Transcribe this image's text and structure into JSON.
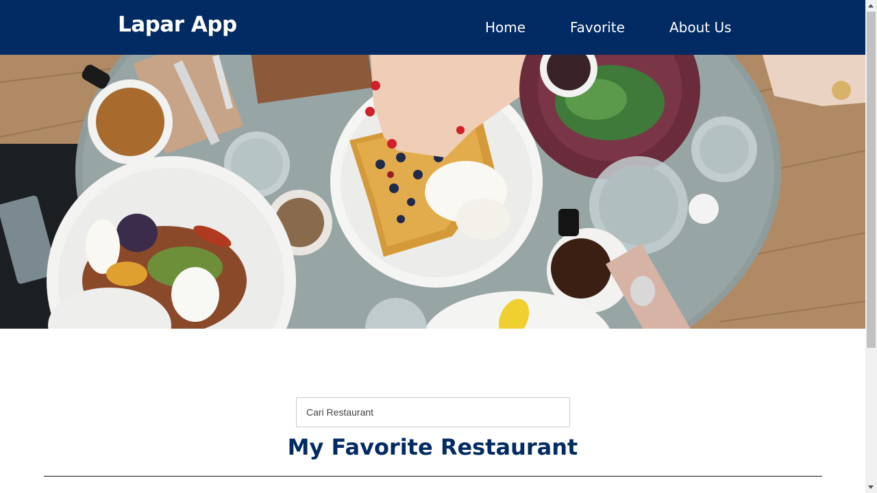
{
  "navbar": {
    "brand": "Lapar App",
    "links": [
      {
        "label": "Home"
      },
      {
        "label": "Favorite"
      },
      {
        "label": "About Us"
      }
    ],
    "background": "#022b63"
  },
  "hero": {
    "image": "hero-food-table-photo"
  },
  "search": {
    "placeholder": "Cari Restaurant",
    "value": ""
  },
  "main": {
    "title": "My Favorite Restaurant",
    "title_color": "#022b63"
  }
}
